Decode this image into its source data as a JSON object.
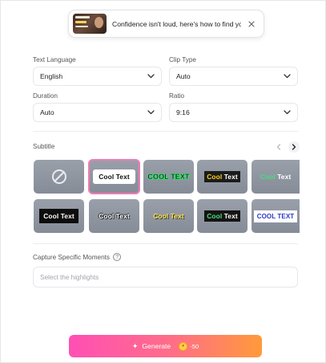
{
  "video": {
    "title": "Confidence isn't loud, here's how to find your ..."
  },
  "fields": {
    "text_language": {
      "label": "Text Language",
      "value": "English"
    },
    "clip_type": {
      "label": "Clip Type",
      "value": "Auto"
    },
    "duration": {
      "label": "Duration",
      "value": "Auto"
    },
    "ratio": {
      "label": "Ratio",
      "value": "9:16"
    }
  },
  "subtitle": {
    "label": "Subtitle",
    "styles": [
      {
        "id": "none",
        "text_a": "",
        "text_b": "",
        "selected": false
      },
      {
        "id": "white-box",
        "text_a": "Cool Text",
        "text_b": "",
        "selected": true
      },
      {
        "id": "green-outline",
        "text_a": "COOL TEXT",
        "text_b": "",
        "selected": false
      },
      {
        "id": "yellow-dark",
        "text_a": "Cool",
        "text_b": "Text",
        "selected": false
      },
      {
        "id": "green-white",
        "text_a": "Cool",
        "text_b": "Text",
        "selected": false
      },
      {
        "id": "black-box",
        "text_a": "Cool Text",
        "text_b": "",
        "selected": false
      },
      {
        "id": "shadow",
        "text_a": "Cool Text",
        "text_b": "",
        "selected": false
      },
      {
        "id": "yellow-shadow",
        "text_a": "Cool",
        "text_b": "Text",
        "selected": false
      },
      {
        "id": "green-yellow",
        "text_a": "Cool",
        "text_b": "Text",
        "selected": false
      },
      {
        "id": "white-blue",
        "text_a": "COOL TEXT",
        "text_b": "",
        "selected": false
      }
    ]
  },
  "capture": {
    "label": "Capture Specific Moments",
    "placeholder": "Select the highlights"
  },
  "generate": {
    "label": "Generate",
    "cost": "-50"
  },
  "colors": {
    "accent_gradient_start": "#ff4fb5",
    "accent_gradient_end": "#ff9a3a",
    "selected_outline": "#f07ab5"
  }
}
